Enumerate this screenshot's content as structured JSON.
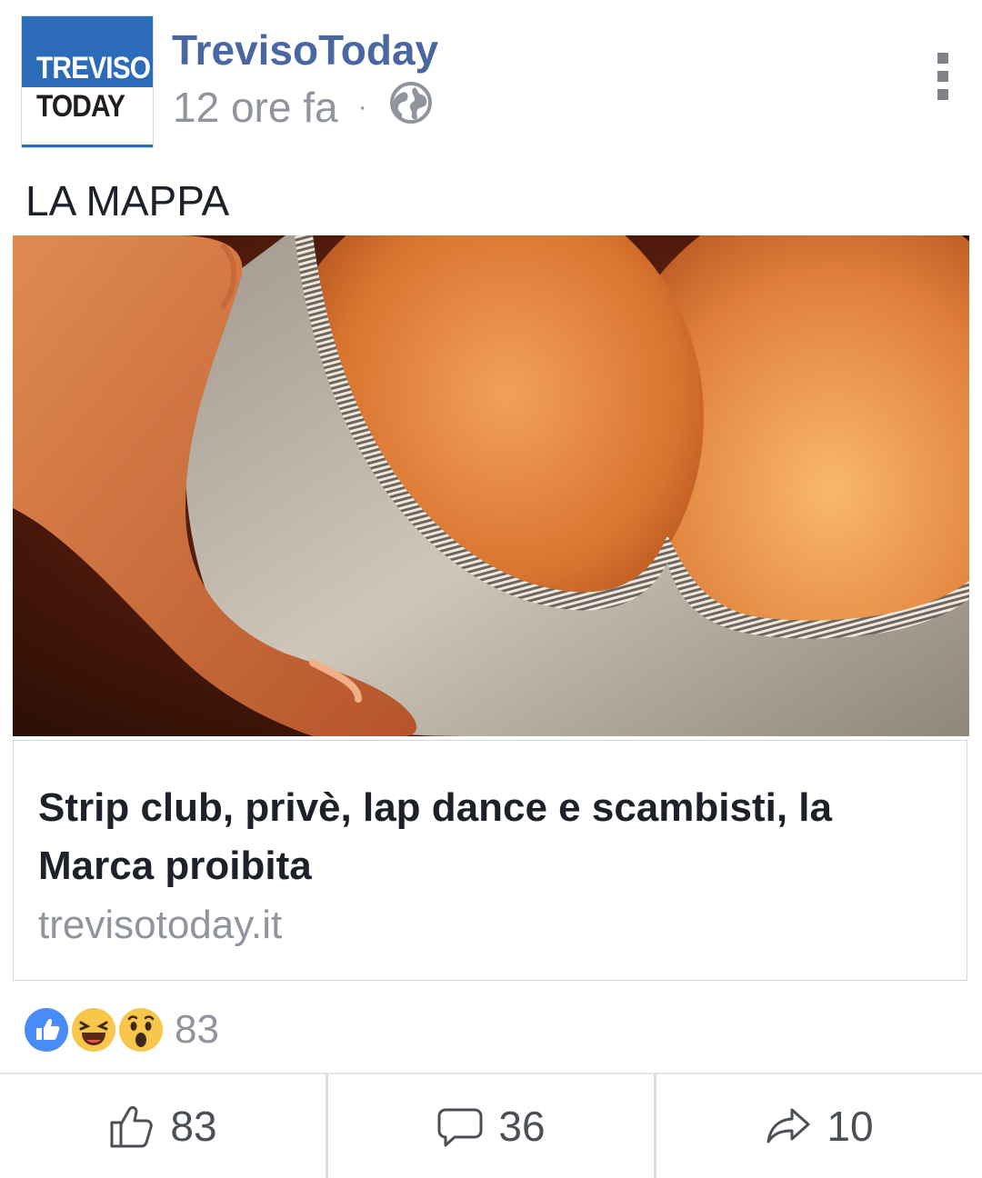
{
  "header": {
    "logo": {
      "line1": "TREVISO",
      "line2": "TODAY"
    },
    "page_name": "TrevisoToday",
    "timestamp": "12 ore fa",
    "separator": "·",
    "privacy_icon": "globe-icon",
    "menu_icon": "more-vertical-icon"
  },
  "post": {
    "caption": "LA MAPPA"
  },
  "link_preview": {
    "title": "Strip club, privè, lap dance e scambisti, la Marca proibita",
    "domain": "trevisotoday.it"
  },
  "reactions": {
    "icons": [
      "like-reaction-icon",
      "haha-reaction-icon",
      "wow-reaction-icon"
    ],
    "count": "83"
  },
  "actions": {
    "like_count": "83",
    "comment_count": "36",
    "share_count": "10"
  },
  "colors": {
    "brand_blue": "#2b6bb8",
    "page_name": "#4b67a1",
    "meta_gray": "#90949c",
    "like_blue": "#4a8cf7",
    "reaction_yellow": "#f7c64a"
  }
}
